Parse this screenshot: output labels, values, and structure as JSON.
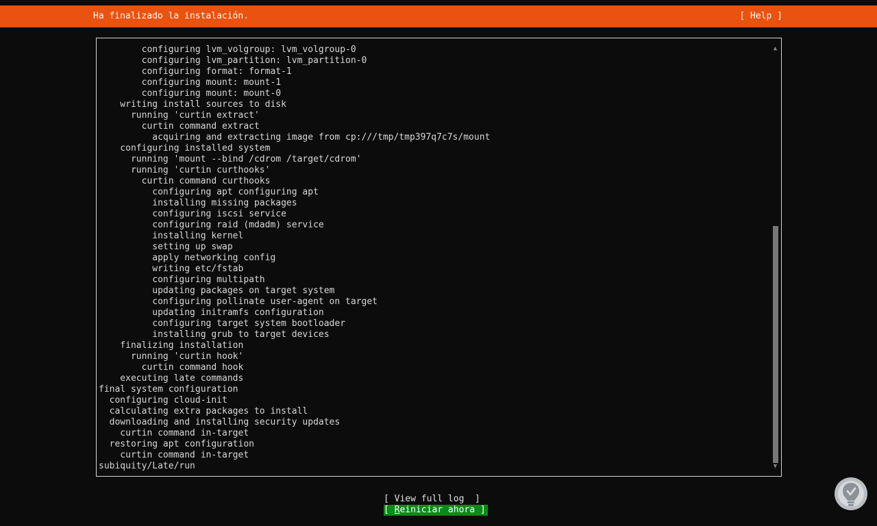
{
  "header": {
    "title": "Ha finalizado la instalación.",
    "help_label": "[ Help ]",
    "background": "#e9520f"
  },
  "log": {
    "lines": [
      "        configuring lvm_volgroup: lvm_volgroup-0",
      "        configuring lvm_partition: lvm_partition-0",
      "        configuring format: format-1",
      "        configuring mount: mount-1",
      "        configuring mount: mount-0",
      "    writing install sources to disk",
      "      running 'curtin extract'",
      "        curtin command extract",
      "          acquiring and extracting image from cp:///tmp/tmp397q7c7s/mount",
      "    configuring installed system",
      "      running 'mount --bind /cdrom /target/cdrom'",
      "      running 'curtin curthooks'",
      "        curtin command curthooks",
      "          configuring apt configuring apt",
      "          installing missing packages",
      "          configuring iscsi service",
      "          configuring raid (mdadm) service",
      "          installing kernel",
      "          setting up swap",
      "          apply networking config",
      "          writing etc/fstab",
      "          configuring multipath",
      "          updating packages on target system",
      "          configuring pollinate user-agent on target",
      "          updating initramfs configuration",
      "          configuring target system bootloader",
      "          installing grub to target devices",
      "    finalizing installation",
      "      running 'curtin hook'",
      "        curtin command hook",
      "    executing late commands",
      "final system configuration",
      "  configuring cloud-init",
      "  calculating extra packages to install",
      "  downloading and installing security updates",
      "    curtin command in-target",
      "  restoring apt configuration",
      "    curtin command in-target",
      "subiquity/Late/run"
    ],
    "scroll_up_icon": "▲",
    "scroll_down_icon": "▼",
    "scroll_position": {
      "start": 0.42,
      "end": 1.0
    }
  },
  "buttons": {
    "view_log": {
      "open": "[ ",
      "label": "View full log",
      "close": "  ]"
    },
    "reboot": {
      "open": "[ ",
      "accel": "R",
      "rest": "einiciar ahora",
      "close": " ]",
      "background": "#0d8a17"
    }
  },
  "watermark": {
    "icon": "solvetic-logo-icon"
  }
}
